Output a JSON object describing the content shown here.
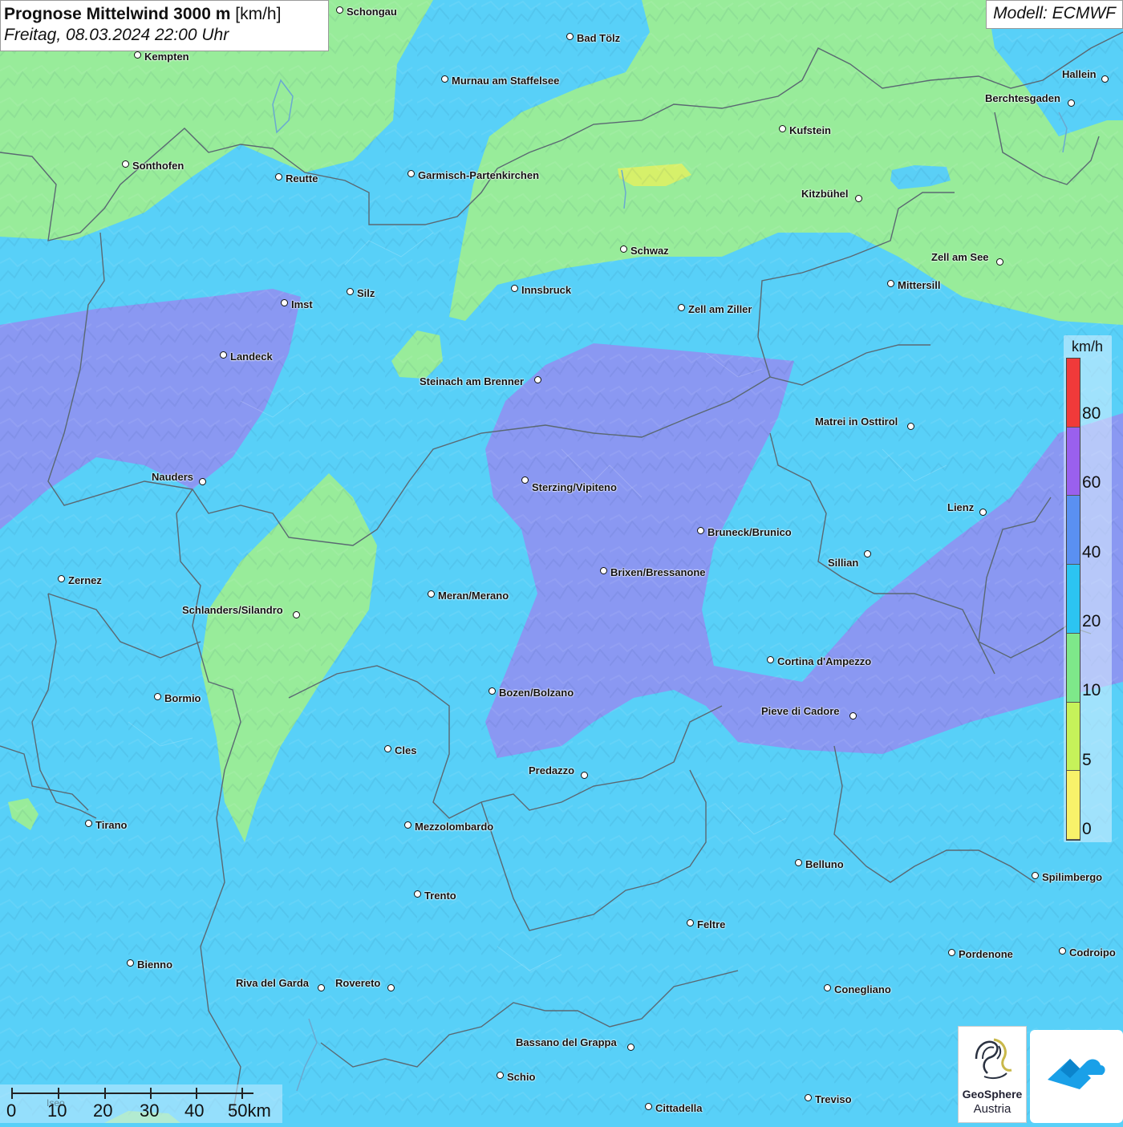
{
  "title": {
    "bold": "Prognose Mittelwind 3000 m",
    "unit": "[km/h]",
    "date": "Freitag, 08.03.2024 22:00 Uhr"
  },
  "model": "Modell: ECMWF",
  "legend": {
    "unit": "km/h",
    "labels": [
      "80",
      "60",
      "40",
      "20",
      "10",
      "5",
      "0"
    ],
    "colors": [
      "#f03a3a",
      "#9a60ee",
      "#5a90f2",
      "#2cc4f2",
      "#7ee88a",
      "#c6f25a",
      "#f8f26a"
    ]
  },
  "scalebar": {
    "labels": [
      "0",
      "10",
      "20",
      "30",
      "40",
      "50km"
    ],
    "faint_label": "Iseo"
  },
  "logos": {
    "geosphere_line1": "GeoSphere",
    "geosphere_line2": "Austria"
  },
  "cities": [
    {
      "name": "Schongau"
    },
    {
      "name": "Bad Tölz"
    },
    {
      "name": "Kempten"
    },
    {
      "name": "Murnau am Staffelsee"
    },
    {
      "name": "Hallein"
    },
    {
      "name": "Berchtesgaden"
    },
    {
      "name": "Kufstein"
    },
    {
      "name": "Sonthofen"
    },
    {
      "name": "Reutte"
    },
    {
      "name": "Garmisch-Partenkirchen"
    },
    {
      "name": "Kitzbühel"
    },
    {
      "name": "Schwaz"
    },
    {
      "name": "Zell am See"
    },
    {
      "name": "Innsbruck"
    },
    {
      "name": "Mittersill"
    },
    {
      "name": "Imst"
    },
    {
      "name": "Silz"
    },
    {
      "name": "Zell am Ziller"
    },
    {
      "name": "Landeck"
    },
    {
      "name": "Steinach am Brenner"
    },
    {
      "name": "Matrei in Osttirol"
    },
    {
      "name": "Nauders"
    },
    {
      "name": "Sterzing/Vipiteno"
    },
    {
      "name": "Lienz"
    },
    {
      "name": "Bruneck/Brunico"
    },
    {
      "name": "Sillian"
    },
    {
      "name": "Brixen/Bressanone"
    },
    {
      "name": "Zernez"
    },
    {
      "name": "Meran/Merano"
    },
    {
      "name": "Schlanders/Silandro"
    },
    {
      "name": "Cortina d'Ampezzo"
    },
    {
      "name": "Bozen/Bolzano"
    },
    {
      "name": "Bormio"
    },
    {
      "name": "Pieve di Cadore"
    },
    {
      "name": "Cles"
    },
    {
      "name": "Predazzo"
    },
    {
      "name": "Tirano"
    },
    {
      "name": "Mezzolombardo"
    },
    {
      "name": "Belluno"
    },
    {
      "name": "Spilimbergo"
    },
    {
      "name": "Trento"
    },
    {
      "name": "Feltre"
    },
    {
      "name": "Pordenone"
    },
    {
      "name": "Codroipo"
    },
    {
      "name": "Bienno"
    },
    {
      "name": "Riva del Garda"
    },
    {
      "name": "Rovereto"
    },
    {
      "name": "Conegliano"
    },
    {
      "name": "Bassano del Grappa"
    },
    {
      "name": "Schio"
    },
    {
      "name": "Treviso"
    },
    {
      "name": "Cittadella"
    }
  ]
}
